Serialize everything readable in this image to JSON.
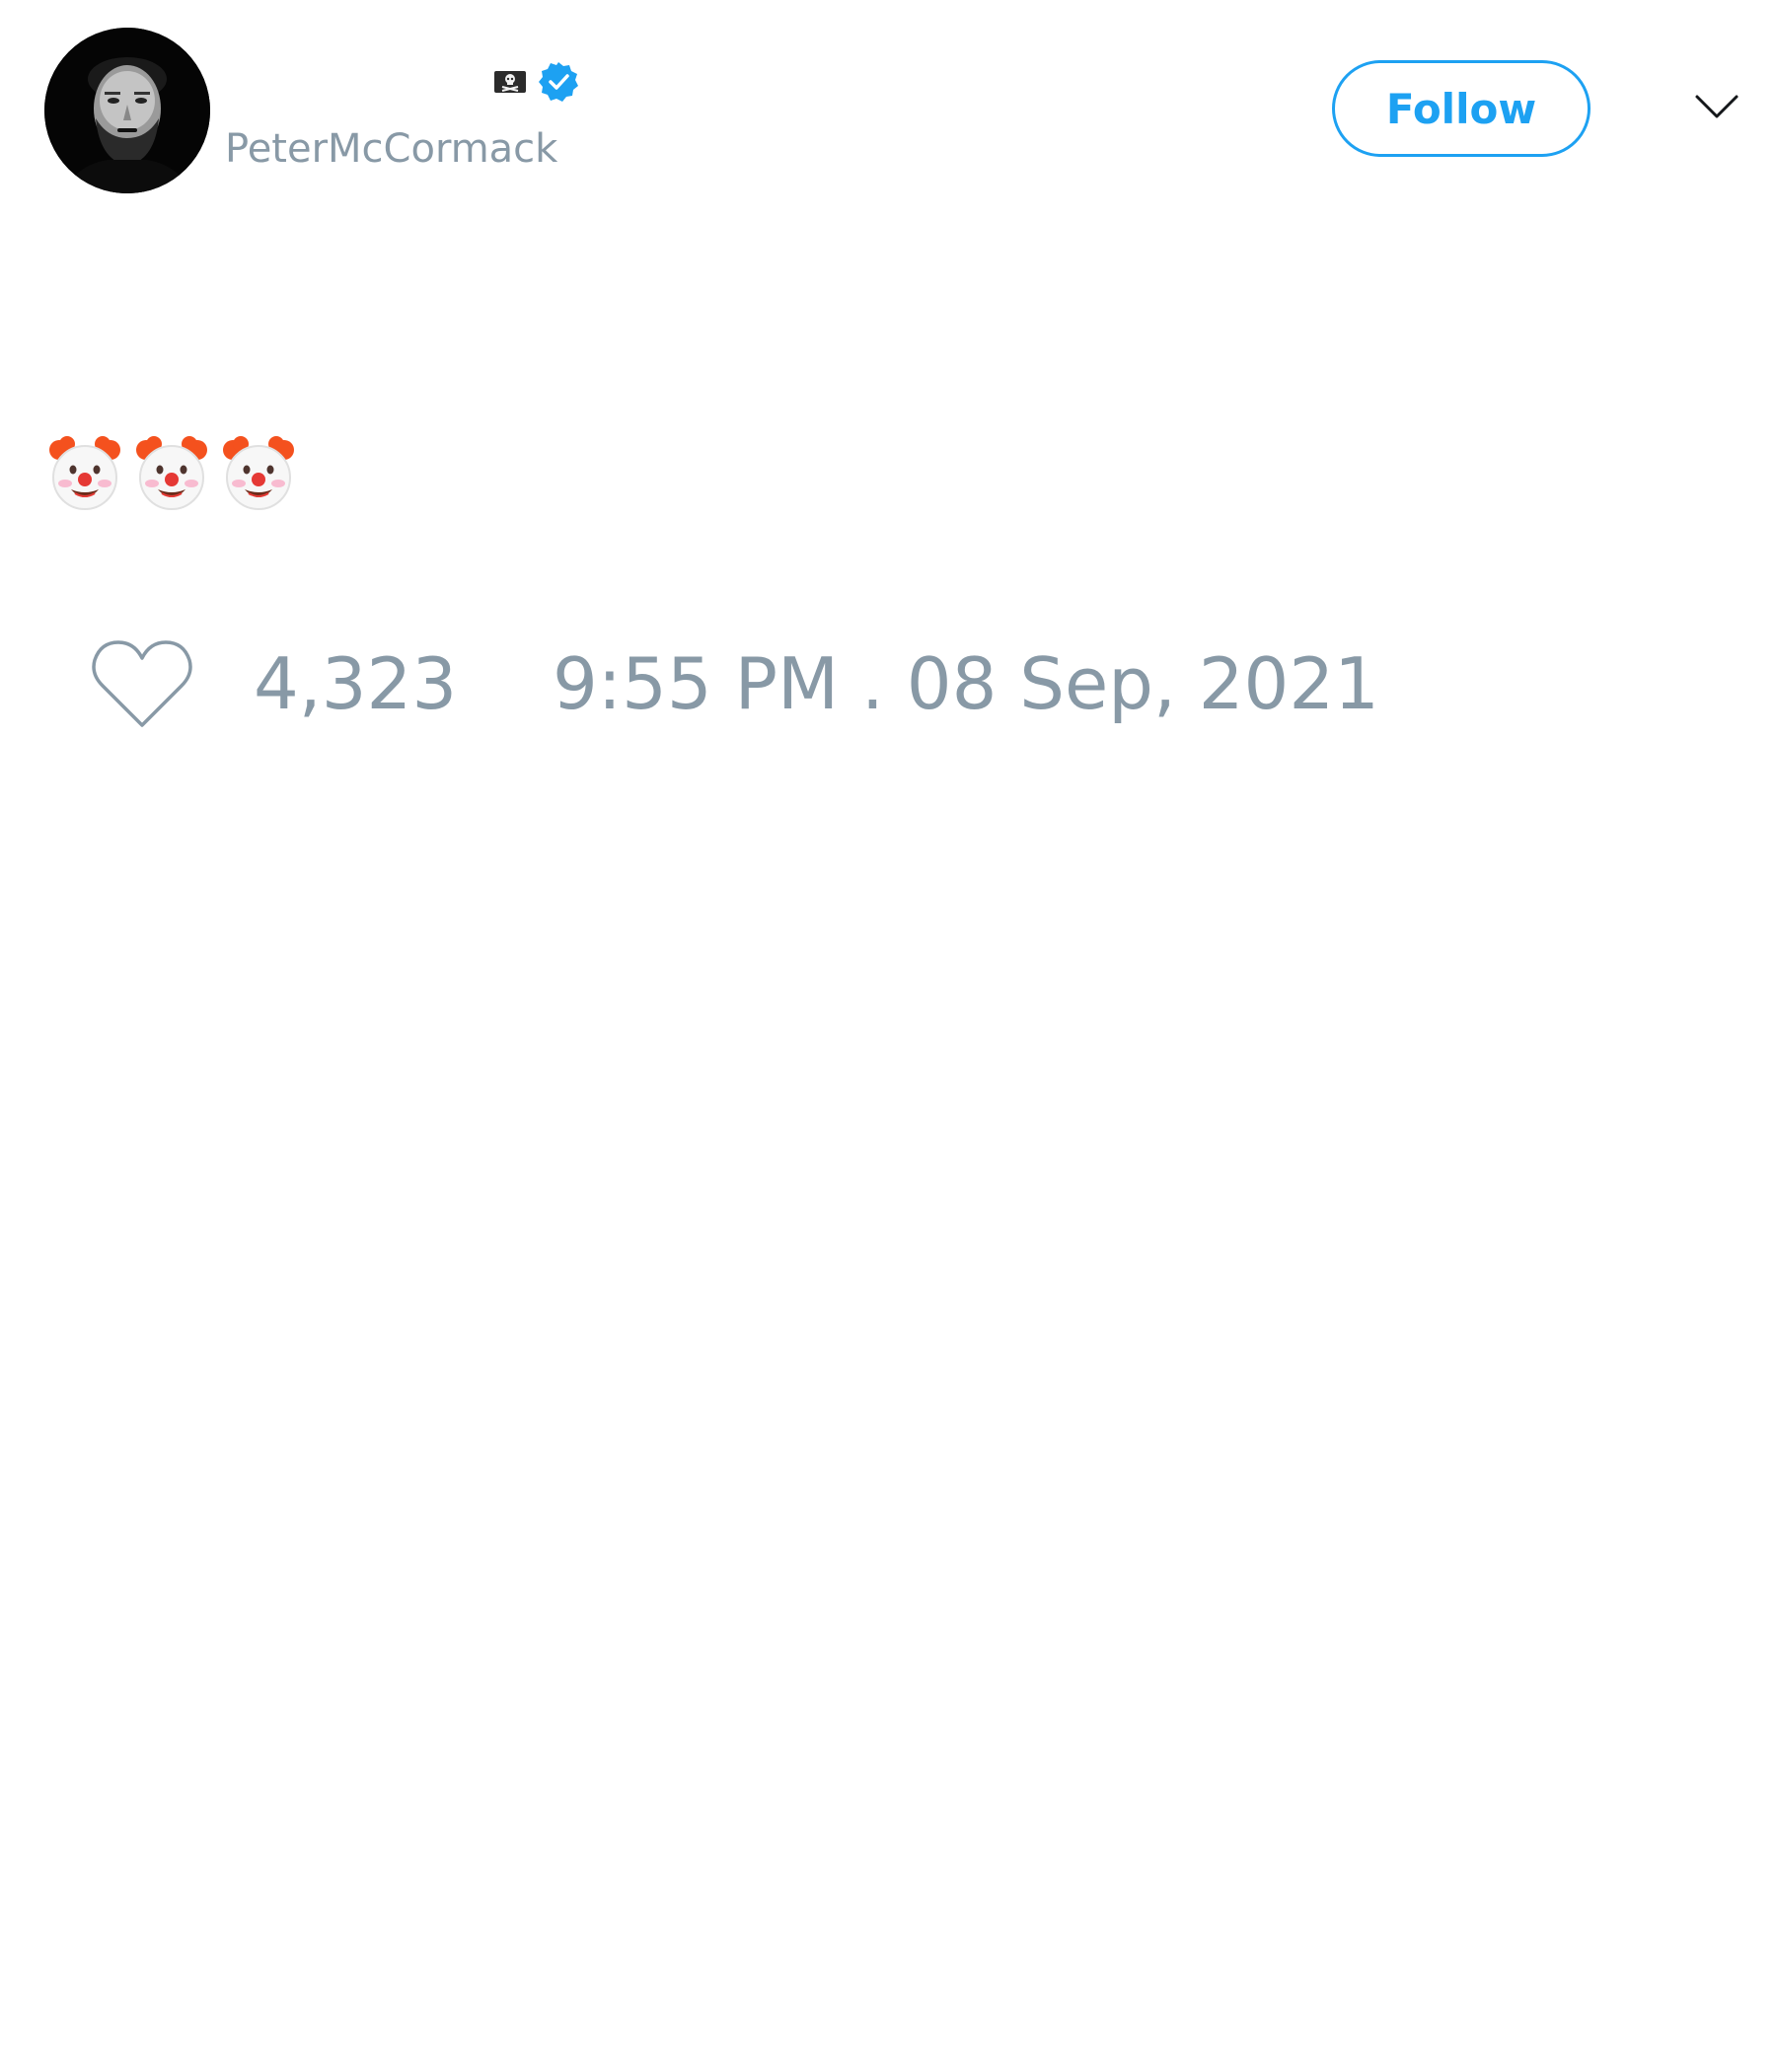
{
  "tweet": {
    "author": {
      "display_name": "",
      "handle": "PeterMcCormack",
      "flag_icon": "pirate-flag-icon",
      "verified_icon": "verified-badge-icon"
    },
    "follow_label": "Follow",
    "menu_icon": "chevron-down-icon",
    "text_emojis": [
      "clown-face-icon",
      "clown-face-icon",
      "clown-face-icon"
    ],
    "like_icon": "heart-icon",
    "like_count": "4,323",
    "timestamp": "9:55 PM . 08 Sep, 2021"
  },
  "colors": {
    "accent": "#1da1f2",
    "muted_text": "#8899a6",
    "text": "#14171a",
    "background": "#ffffff"
  }
}
